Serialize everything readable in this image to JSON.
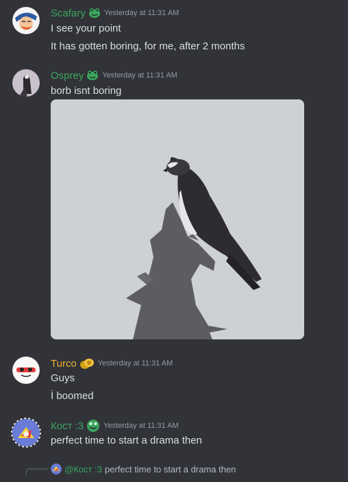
{
  "colors": {
    "background": "#313338",
    "timestamp": "#949ba4",
    "text": "#dbdee1",
    "name_green": "#3ba55d",
    "name_gold": "#f0b232"
  },
  "messages": [
    {
      "author": "Scafary",
      "author_color": "#3ba55d",
      "badge": "frog-icon",
      "timestamp": "Yesterday at 11:31 AM",
      "lines": [
        "I see your point",
        "It has gotten boring, for me, after 2 months"
      ]
    },
    {
      "author": "Osprey",
      "author_color": "#3ba55d",
      "badge": "frog-icon",
      "timestamp": "Yesterday at 11:31 AM",
      "lines": [
        "borb isnt boring"
      ],
      "attachment": "osprey-photo"
    },
    {
      "author": "Turco",
      "author_color": "#f0b232",
      "badge": "gold-coin-icon",
      "timestamp": "Yesterday at 11:31 AM",
      "lines": [
        "Guys",
        "İ boomed"
      ]
    },
    {
      "author": "Кост :3",
      "author_color": "#3ba55d",
      "badge": "frog-icon",
      "timestamp": "Yesterday at 11:31 AM",
      "lines": [
        "perfect time to start a drama then"
      ]
    }
  ],
  "reply_preview": {
    "mention": "@Кост :3",
    "text": "perfect time to start a drama then"
  }
}
